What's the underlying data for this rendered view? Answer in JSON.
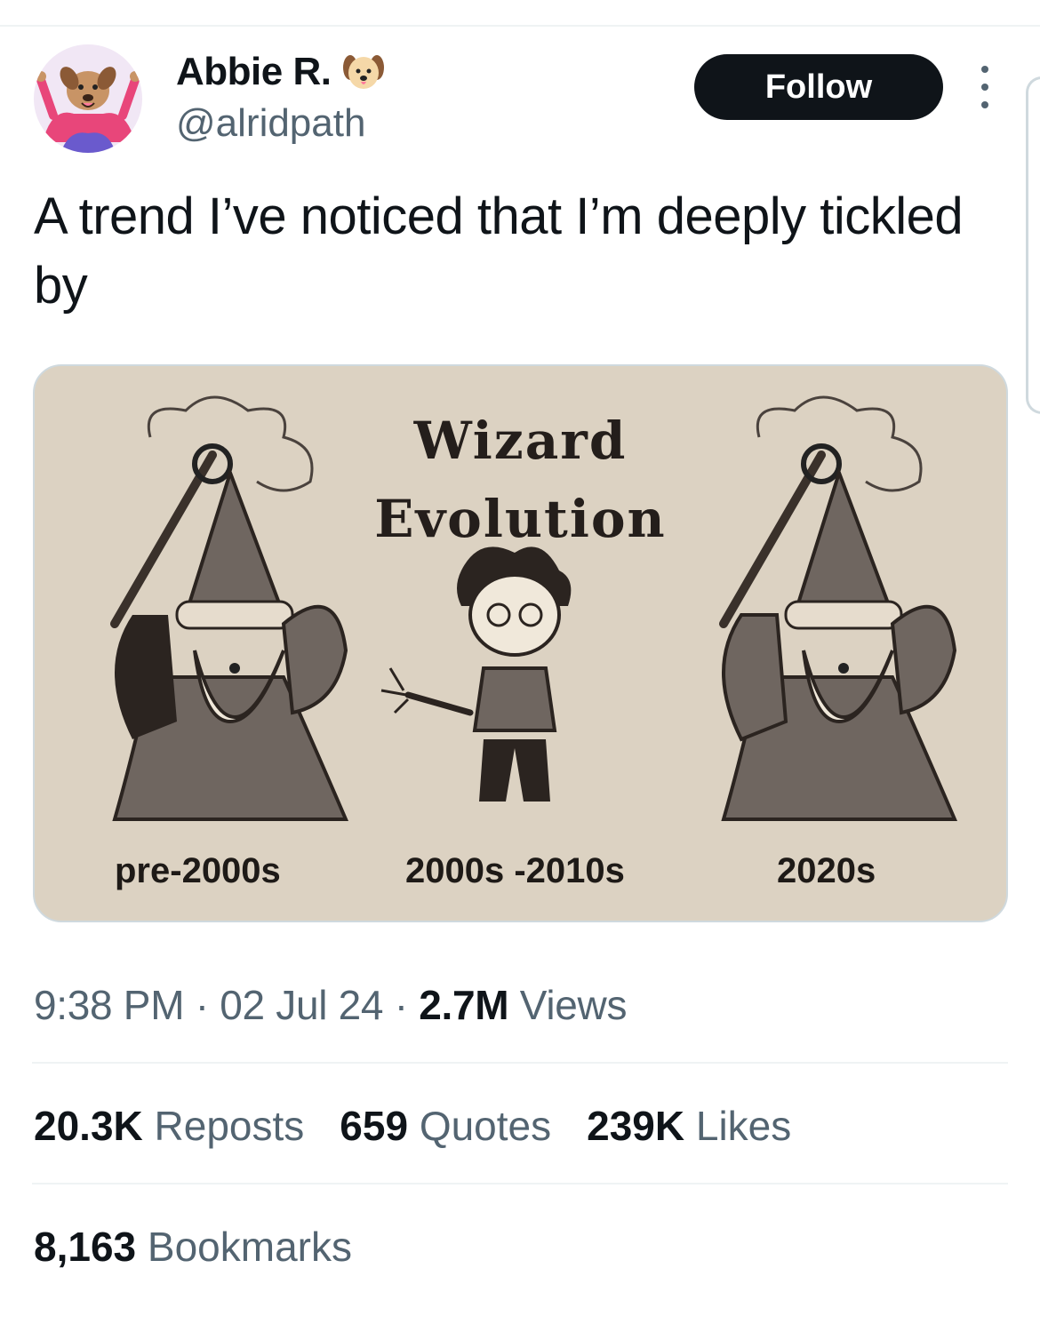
{
  "author": {
    "display_name": "Abbie R.",
    "badge_icon": "dog-face-icon",
    "handle": "@alridpath",
    "avatar_icon": "dog-character-avatar"
  },
  "follow_label": "Follow",
  "tweet": {
    "text": "A trend I’ve noticed that I’m deeply tickled by"
  },
  "media": {
    "title_line1": "Wizard",
    "title_line2": "Evolution",
    "labels": [
      "pre-2000s",
      "2000s -2010s",
      "2020s"
    ]
  },
  "meta": {
    "time": "9:38 PM",
    "sep1": "·",
    "date": "02 Jul 24",
    "sep2": "·",
    "views_count": "2.7M",
    "views_label": "Views"
  },
  "stats": {
    "reposts_count": "20.3K",
    "reposts_label": "Reposts",
    "quotes_count": "659",
    "quotes_label": "Quotes",
    "likes_count": "239K",
    "likes_label": "Likes",
    "bookmarks_count": "8,163",
    "bookmarks_label": "Bookmarks"
  },
  "colors": {
    "text_primary": "#0f1419",
    "text_secondary": "#536471",
    "follow_bg": "#0f1419",
    "media_bg": "#dcd2c2",
    "divider": "#eff3f4"
  }
}
